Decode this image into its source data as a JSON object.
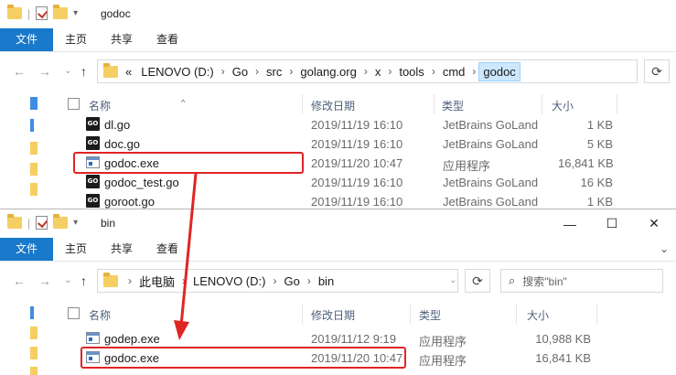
{
  "window1": {
    "title": "godoc",
    "ribbon_tabs": [
      "文件",
      "主页",
      "共享",
      "查看"
    ],
    "address": {
      "overflow": "«",
      "crumbs": [
        "LENOVO (D:)",
        "Go",
        "src",
        "golang.org",
        "x",
        "tools",
        "cmd",
        "godoc"
      ]
    },
    "columns": {
      "name": "名称",
      "date": "修改日期",
      "type": "类型",
      "size": "大小"
    },
    "files": [
      {
        "name": "dl.go",
        "date": "2019/11/19 16:10",
        "type": "JetBrains GoLand",
        "size": "1 KB",
        "icon": "go-file-icon"
      },
      {
        "name": "doc.go",
        "date": "2019/11/19 16:10",
        "type": "JetBrains GoLand",
        "size": "5 KB",
        "icon": "go-file-icon"
      },
      {
        "name": "godoc.exe",
        "date": "2019/11/20 10:47",
        "type": "应用程序",
        "size": "16,841 KB",
        "icon": "exe-icon"
      },
      {
        "name": "godoc_test.go",
        "date": "2019/11/19 16:10",
        "type": "JetBrains GoLand",
        "size": "16 KB",
        "icon": "go-file-icon"
      },
      {
        "name": "goroot.go",
        "date": "2019/11/19 16:10",
        "type": "JetBrains GoLand",
        "size": "1 KB",
        "icon": "go-file-icon"
      }
    ]
  },
  "window2": {
    "title": "bin",
    "ribbon_tabs": [
      "文件",
      "主页",
      "共享",
      "查看"
    ],
    "address": {
      "crumbs": [
        "此电脑",
        "LENOVO (D:)",
        "Go",
        "bin"
      ]
    },
    "search_placeholder": "搜索\"bin\"",
    "columns": {
      "name": "名称",
      "date": "修改日期",
      "type": "类型",
      "size": "大小"
    },
    "files": [
      {
        "name": "godep.exe",
        "date": "2019/11/12 9:19",
        "type": "应用程序",
        "size": "10,988 KB",
        "icon": "exe-icon"
      },
      {
        "name": "godoc.exe",
        "date": "2019/11/20 10:47",
        "type": "应用程序",
        "size": "16,841 KB",
        "icon": "exe-icon"
      }
    ]
  },
  "colors": {
    "accent": "#1979ca",
    "highlight": "#e02424",
    "selected_crumb": "#cce8ff"
  }
}
